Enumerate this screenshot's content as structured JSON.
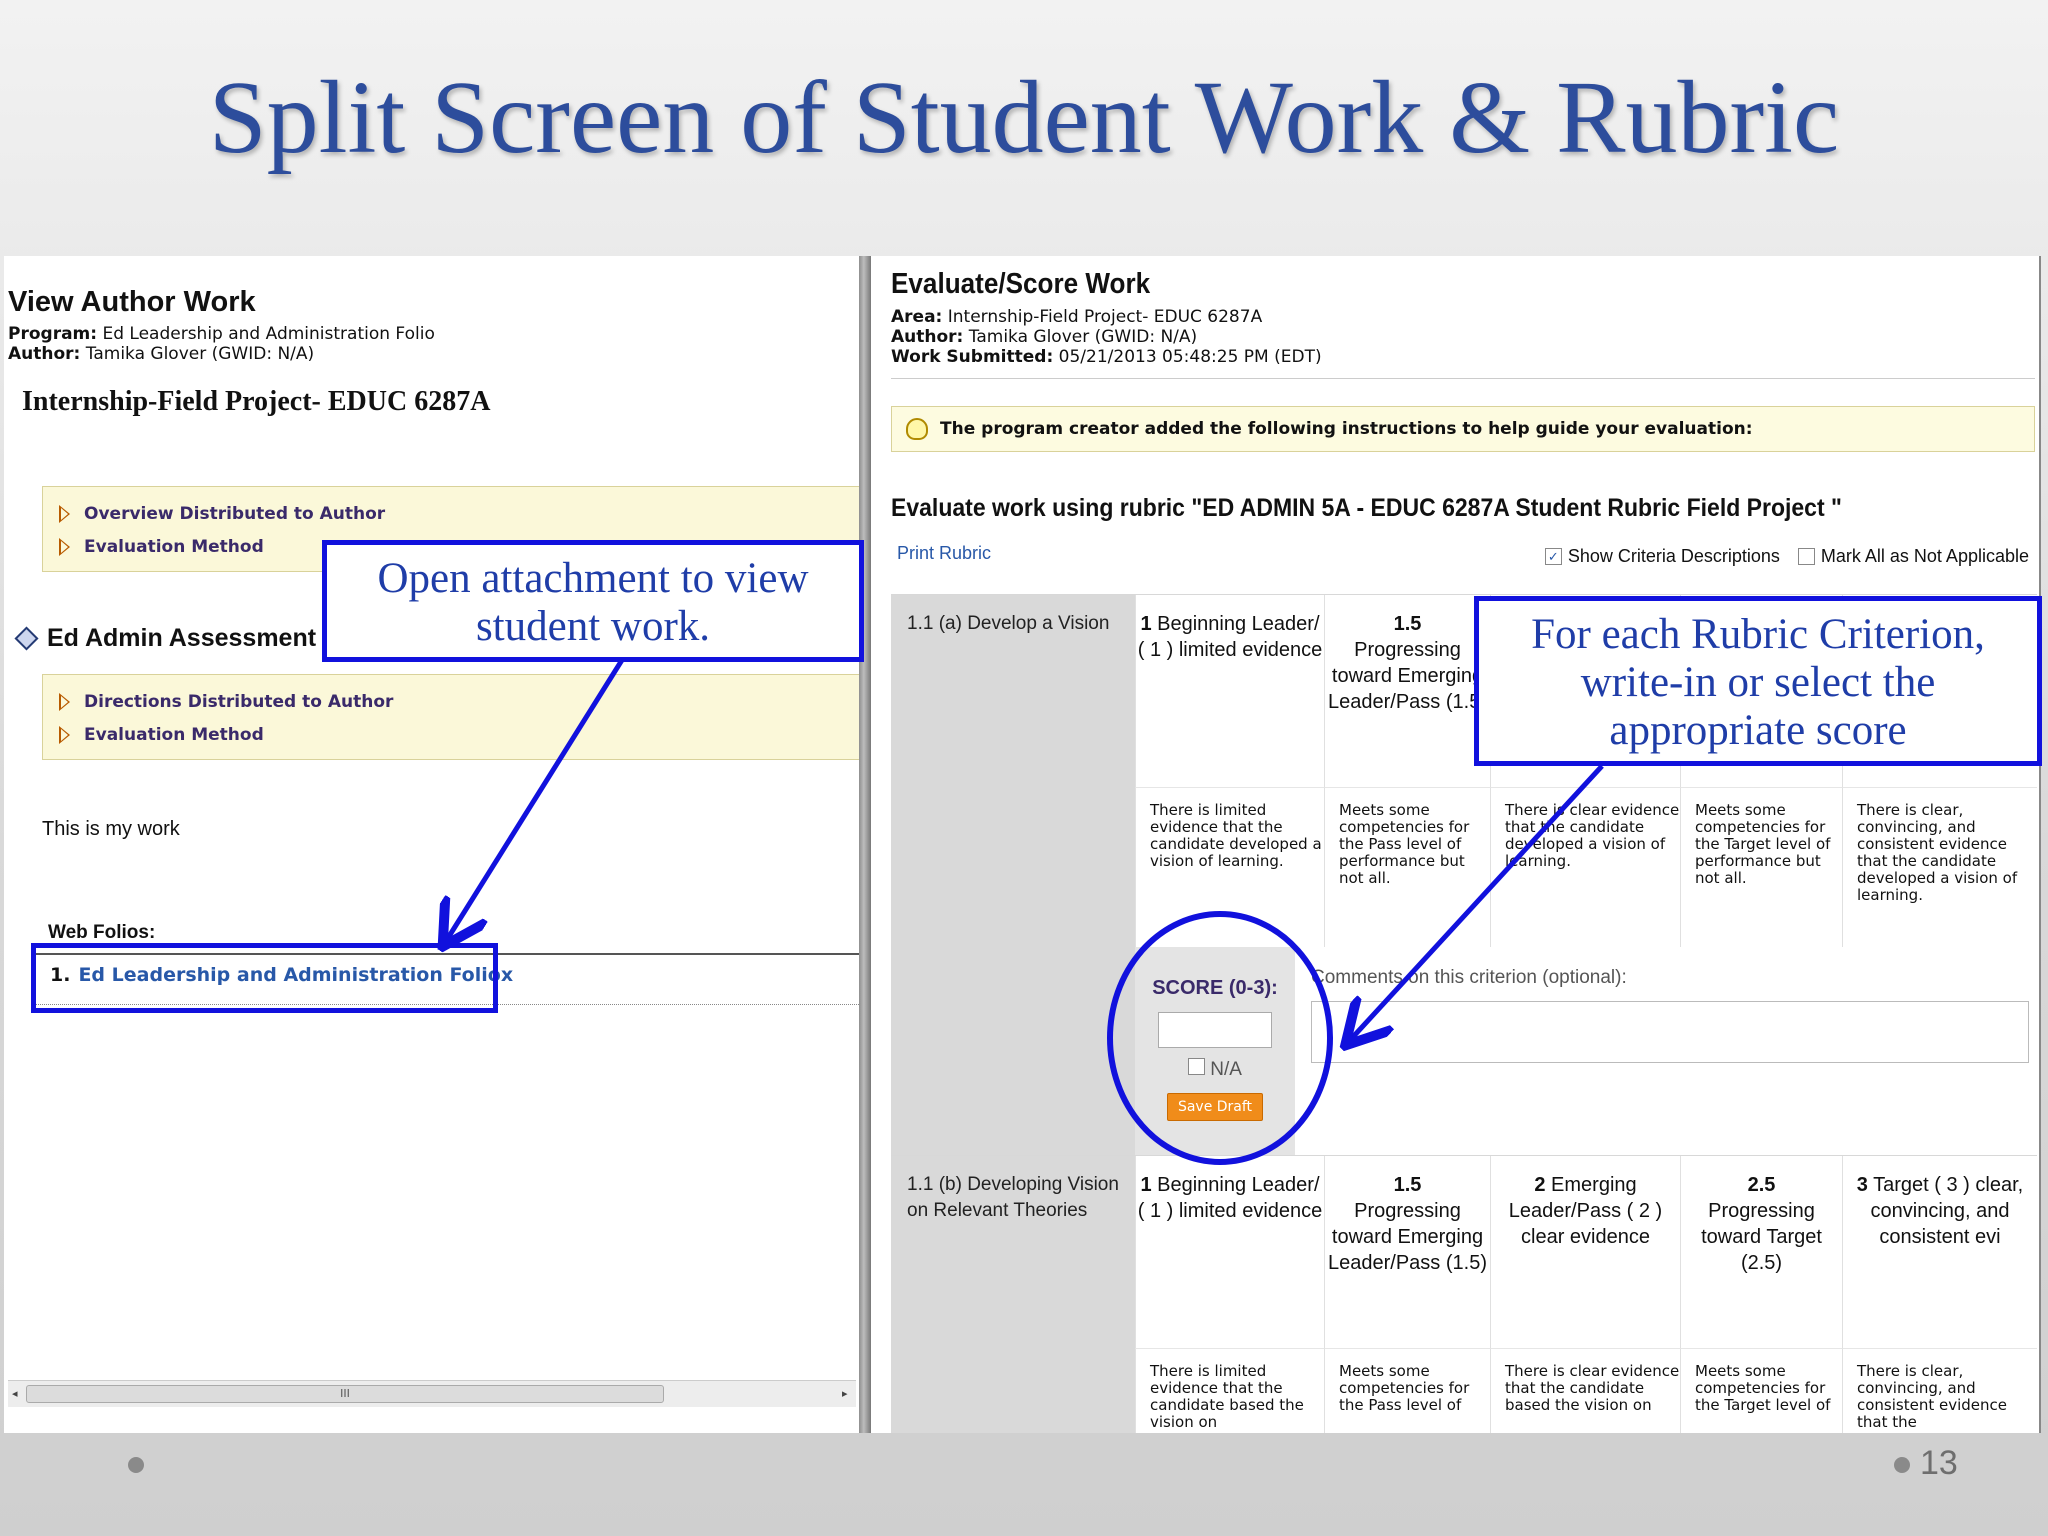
{
  "slide": {
    "title": "Split Screen of Student Work & Rubric",
    "page_number": "13"
  },
  "left": {
    "heading": "View Author Work",
    "program_label": "Program:",
    "program_value": "Ed Leadership and Administration Folio",
    "author_label": "Author:",
    "author_value": "Tamika Glover (GWID: N/A)",
    "project_title": "Internship-Field Project- EDUC 6287A",
    "box1": [
      "Overview Distributed to Author",
      "Evaluation Method"
    ],
    "section_title": "Ed Admin Assessment 5A",
    "box2": [
      "Directions Distributed to Author",
      "Evaluation Method"
    ],
    "work_text": "This is my work",
    "web_folios_label": "Web Folios:",
    "folio_number": "1.",
    "folio_link": "Ed Leadership and Administration Foliox",
    "scroll_grip": "III"
  },
  "right": {
    "heading": "Evaluate/Score Work",
    "area_label": "Area:",
    "area_value": "Internship-Field Project- EDUC 6287A",
    "author_label": "Author:",
    "author_value": "Tamika Glover (GWID: N/A)",
    "submitted_label": "Work Submitted:",
    "submitted_value": "05/21/2013 05:48:25 PM (EDT)",
    "instructions": "The program creator added the following instructions to help guide your evaluation:",
    "rubric_title": "Evaluate work using rubric \"ED ADMIN 5A - EDUC 6287A Student Rubric Field Project \"",
    "print_rubric": "Print Rubric",
    "show_criteria": "Show Criteria Descriptions",
    "mark_all": "Mark All as Not Applicable",
    "criteria": [
      {
        "name": "1.1 (a) Develop a Vision",
        "levels": [
          {
            "score": "1",
            "text": "Beginning Leader/ ( 1 ) limited evidence"
          },
          {
            "score": "1.5",
            "text": "Progressing toward Emerging Leader/Pass (1.5)"
          },
          {
            "score": "",
            "text": ""
          },
          {
            "score": "",
            "text": ""
          },
          {
            "score": "",
            "text": ""
          }
        ],
        "descriptions": [
          "There is limited evidence that the candidate developed a vision of learning.",
          "Meets some competencies for the Pass level of performance but not all.",
          "There is clear evidence that the candidate developed a vision of learning.",
          "Meets some competencies for the Target level of performance but not all.",
          "There is clear, convincing, and consistent evidence that the candidate developed a vision of learning."
        ]
      },
      {
        "name": "1.1 (b) Developing Vision on Relevant Theories",
        "levels": [
          {
            "score": "1",
            "text": "Beginning Leader/ ( 1 ) limited evidence"
          },
          {
            "score": "1.5",
            "text": "Progressing toward Emerging Leader/Pass (1.5)"
          },
          {
            "score": "2",
            "text": "Emerging Leader/Pass ( 2 ) clear evidence"
          },
          {
            "score": "2.5",
            "text": "Progressing toward Target (2.5)"
          },
          {
            "score": "3",
            "text": "Target ( 3 ) clear, convincing, and consistent evi"
          }
        ],
        "descriptions": [
          "There is limited evidence that the candidate based the vision on",
          "Meets some competencies for the Pass level of",
          "There is clear evidence that the candidate based the vision on",
          "Meets some competencies for the Target level of",
          "There is clear, convincing, and consistent evidence that the"
        ]
      }
    ],
    "score_label": "SCORE (0-3):",
    "na_label": "N/A",
    "save_draft": "Save Draft",
    "comments_label": "Comments on this criterion (optional):"
  },
  "annotations": {
    "left_callout": "Open attachment to view student work.",
    "right_callout": "For each Rubric Criterion, write-in or select the appropriate score",
    "color": "#1111dd"
  }
}
